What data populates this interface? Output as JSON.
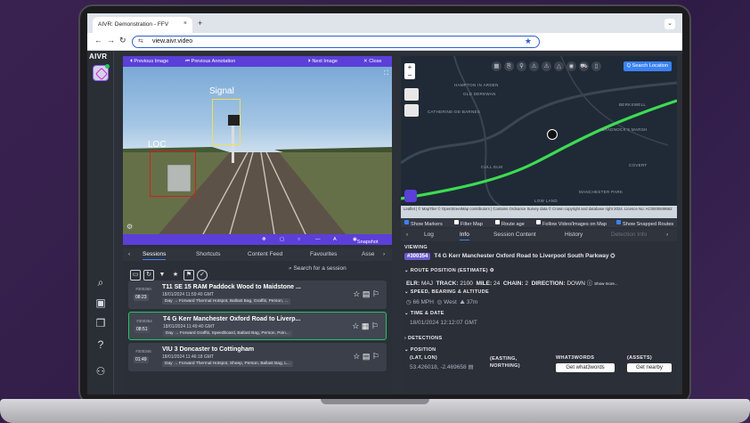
{
  "browser": {
    "tab_title": "AIVR: Demonstration - FFV",
    "tab_close": "×",
    "new_tab": "+",
    "url": "view.aivr.video"
  },
  "app": {
    "logo_text": "AIVR"
  },
  "viewer": {
    "toolbar": {
      "previous_image": "⏴ Previous Image",
      "previous_annotation": "⏮ Previous Annotation",
      "next_image": "⏵ Next Image",
      "close": "✕ Close"
    },
    "annotations": [
      {
        "label": "Signal",
        "color": "#f0e050"
      },
      {
        "label": "LOC",
        "color": "#d02020"
      }
    ],
    "bottom": {
      "snapshot": "Snapshot"
    }
  },
  "map": {
    "search_location": "Q Search Location",
    "labels": [
      "HAMPTON IN ARDEN",
      "OLD DEREWAN",
      "BERKSWELL",
      "BRADNOCK'S MARSH",
      "CATHERINE-DE-BARNES",
      "CULL ELM",
      "MANCHESTER PARK",
      "COVERT",
      "LOW LAND"
    ],
    "attribution": "Leaflet | © MapTiler © OpenStreetMap contributors | Contains Ordnance Survey data © Crown copyright and database right 2024. Licence No: AC0000849662",
    "options": [
      {
        "label": "Show Markers",
        "checked": true
      },
      {
        "label": "Filter Map",
        "checked": false
      },
      {
        "label": "Route age",
        "checked": false
      },
      {
        "label": "Follow Video/Images on Map",
        "checked": false
      },
      {
        "label": "Show Snapped Routes",
        "checked": true
      }
    ]
  },
  "info": {
    "tabs": [
      "Log",
      "Info",
      "Session Content",
      "History",
      "Detection Info"
    ],
    "active_tab": "Info",
    "viewing_label": "VIEWING",
    "session_id": "#300354",
    "session_title": "T4 G Kerr Manchester Oxford Road to Liverpool South Parkway",
    "route_position_label": "ROUTE POSITION (ESTIMATE)",
    "elr_label": "ELR:",
    "elr_value": "MAJ",
    "track_label": "TRACK:",
    "track_value": "2100",
    "mile_label": "MILE:",
    "mile_value": "24",
    "chain_label": "CHAIN:",
    "chain_value": "2",
    "direction_label": "DIRECTION:",
    "direction_value": "DOWN",
    "show_more": "Show more...",
    "speed_label": "SPEED, BEARING & ALTITUDE",
    "speed_value": "66 MPH",
    "bearing_value": "West",
    "altitude_value": "37m",
    "time_label": "TIME & DATE",
    "time_value": "18/01/2024 12:12:07 GMT",
    "detections_label": "DETECTIONS",
    "position_label": "POSITION",
    "latlon_label": "(LAT, LON)",
    "latlon_value": "53.426018, -2.469658",
    "easting_label": "(EASTING, NORTHING)",
    "w3w_label": "WHAT3WORDS",
    "w3w_button": "Get what3words",
    "assets_label": "(ASSETS)",
    "assets_button": "Get nearby"
  },
  "sessions": {
    "tabs": [
      "Sessions",
      "Shortcuts",
      "Content Feed",
      "Favourites",
      "Asse"
    ],
    "active_tab": "Sessions",
    "search_placeholder": "Search for a session",
    "items": [
      {
        "id": "#300350",
        "time": "08:23",
        "title": "T11 SE 15 RAM Paddock Wood to Maidstone ...",
        "date": "18/01/2024 11:59:40 GMT",
        "tags": "Day  → Forward  Thermal Hotspot, Ballast Bag, Graffiti, Person, ..."
      },
      {
        "id": "#300354",
        "time": "08:51",
        "title": "T4 G Kerr Manchester Oxford Road to Liverp...",
        "date": "18/01/2024 11:49:40 GMT",
        "tags": "Day  → Forward  Graffiti, Speedboard, Ballast Bag, Person, Poin..."
      },
      {
        "id": "#300346",
        "time": "01:49",
        "title": "VIU 3 Doncaster to Cottingham",
        "date": "18/01/2024 11:46:18 GMT",
        "tags": "Day  → Forward  Thermal Hotspot, Sheep, Person, Ballast Bag, L..."
      }
    ]
  },
  "colors": {
    "accent": "#5b3fd8",
    "route_green": "#3ddc52",
    "active_session": "#22c55e",
    "link_blue": "#3b82f6"
  }
}
